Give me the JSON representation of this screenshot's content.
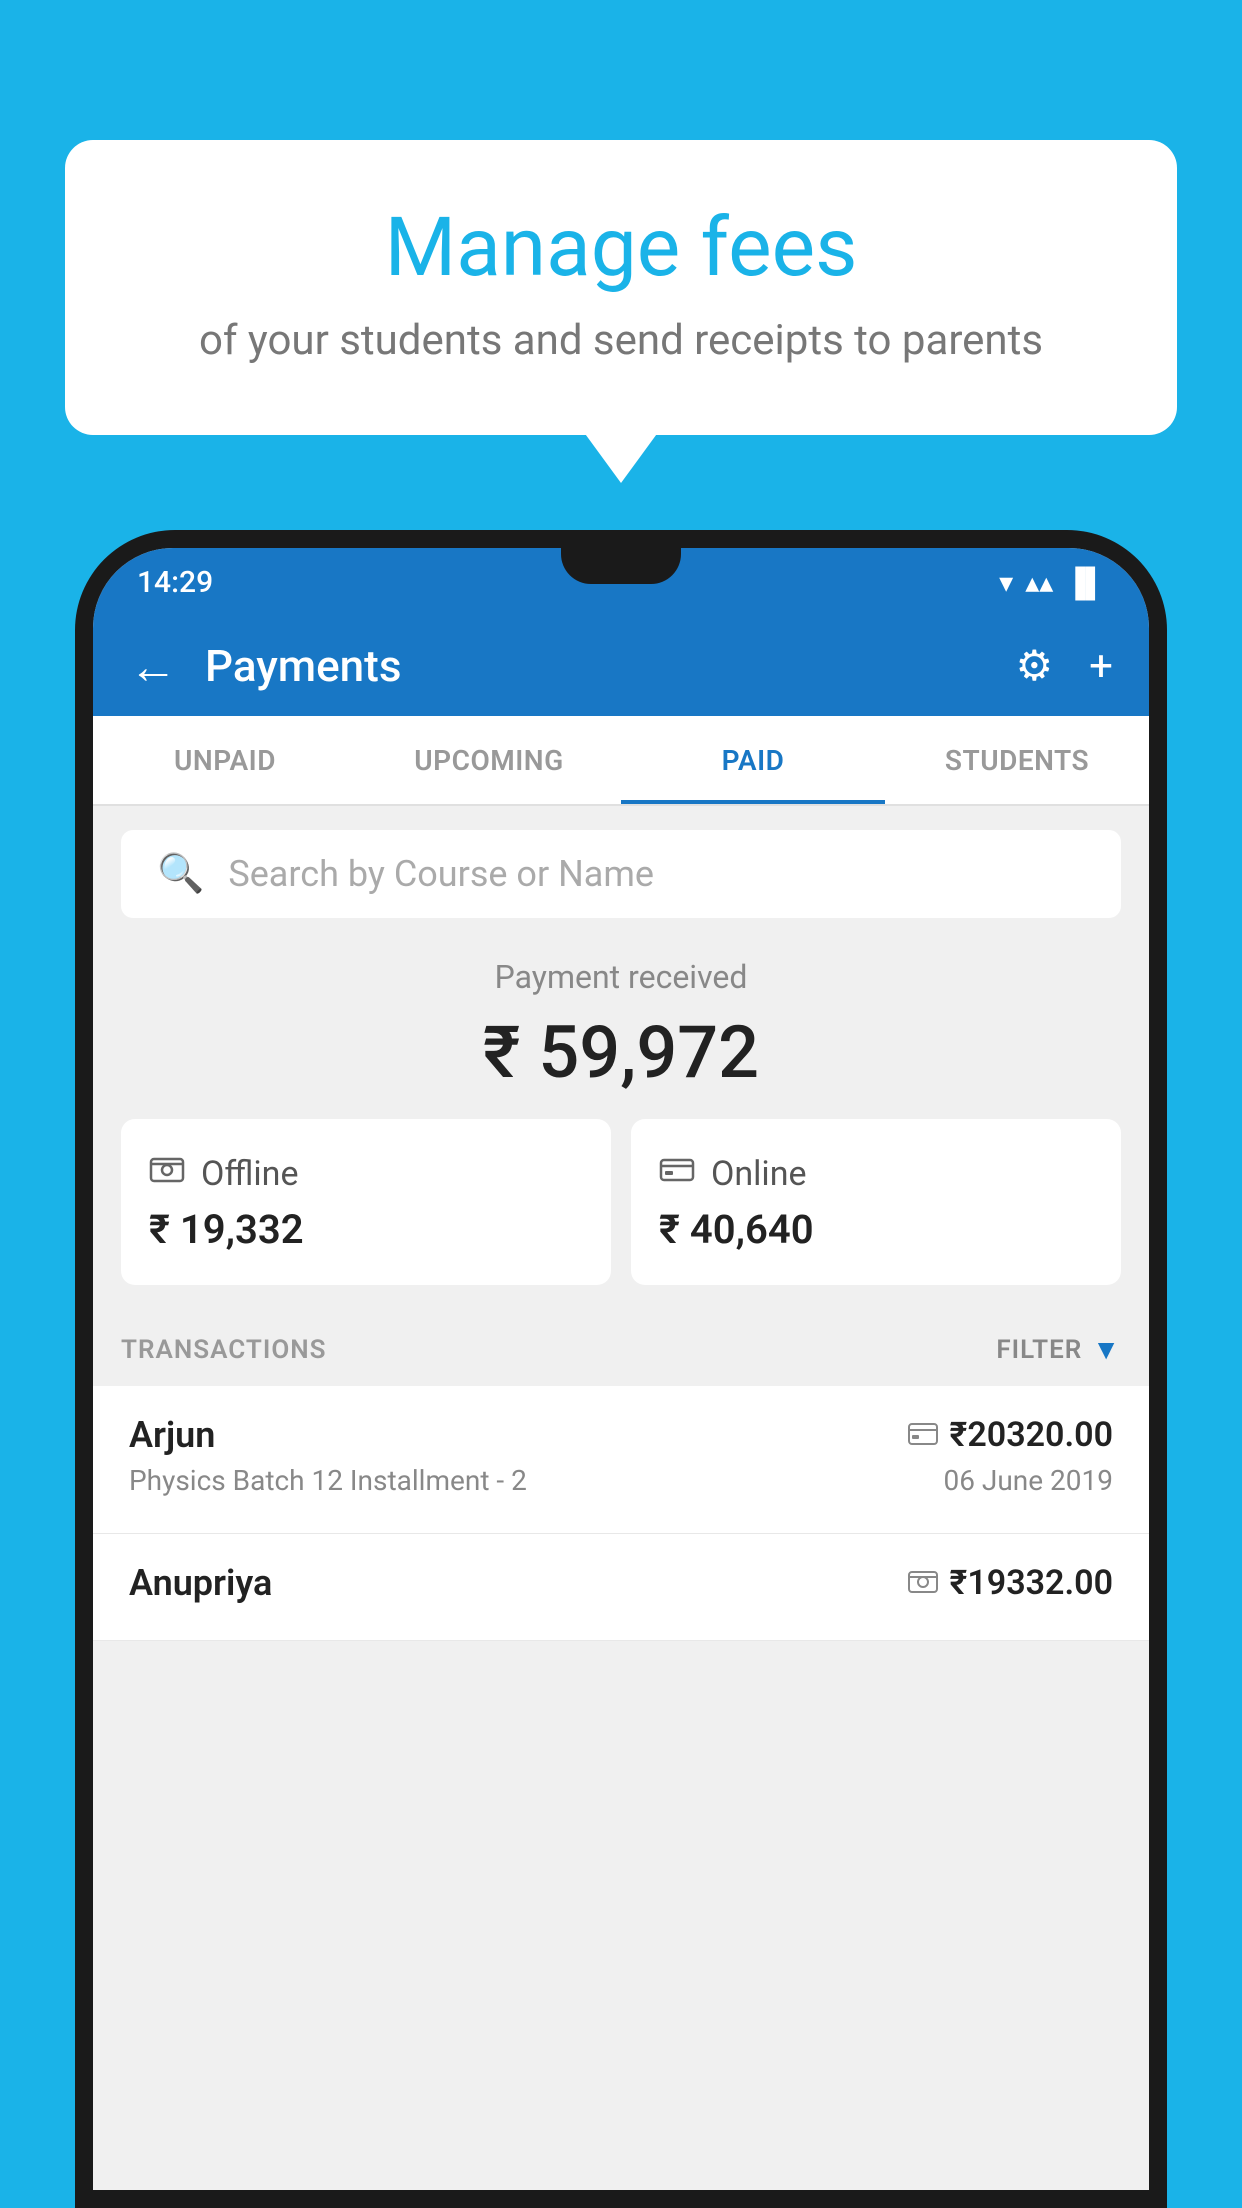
{
  "background_color": "#1ab3e8",
  "speech_bubble": {
    "title": "Manage fees",
    "subtitle": "of your students and send receipts to parents"
  },
  "status_bar": {
    "time": "14:29",
    "wifi_icon": "▼",
    "signal_icon": "▲",
    "battery_icon": "▐"
  },
  "app_bar": {
    "title": "Payments",
    "back_label": "←",
    "settings_label": "⚙",
    "add_label": "+"
  },
  "tabs": [
    {
      "label": "UNPAID",
      "active": false
    },
    {
      "label": "UPCOMING",
      "active": false
    },
    {
      "label": "PAID",
      "active": true
    },
    {
      "label": "STUDENTS",
      "active": false
    }
  ],
  "search": {
    "placeholder": "Search by Course or Name"
  },
  "payment_summary": {
    "label": "Payment received",
    "amount": "₹ 59,972"
  },
  "payment_cards": [
    {
      "icon": "💳",
      "label": "Offline",
      "amount": "₹ 19,332"
    },
    {
      "icon": "💳",
      "label": "Online",
      "amount": "₹ 40,640"
    }
  ],
  "transactions_section": {
    "label": "TRANSACTIONS",
    "filter_label": "FILTER"
  },
  "transactions": [
    {
      "name": "Arjun",
      "course": "Physics Batch 12 Installment - 2",
      "amount": "₹20320.00",
      "date": "06 June 2019",
      "payment_type": "online"
    },
    {
      "name": "Anupriya",
      "course": "",
      "amount": "₹19332.00",
      "date": "",
      "payment_type": "offline"
    }
  ]
}
